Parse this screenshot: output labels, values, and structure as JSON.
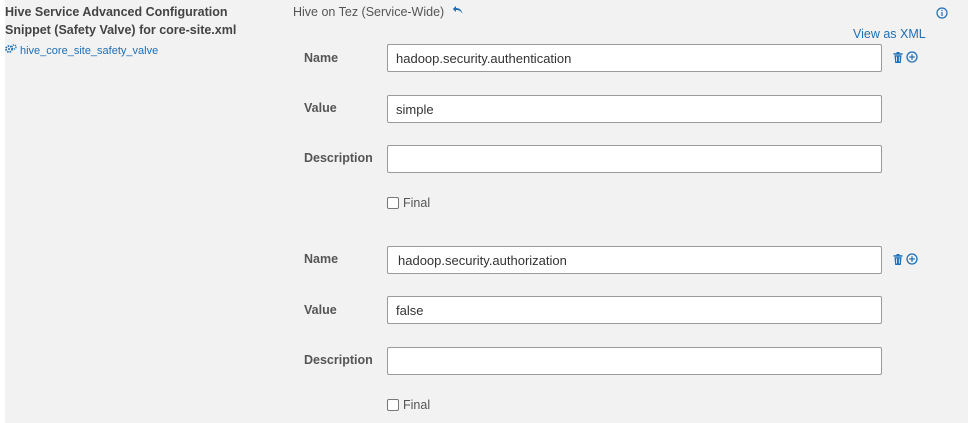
{
  "property": {
    "title": "Hive Service Advanced Configuration Snippet (Safety Valve) for core-site.xml",
    "key": "hive_core_site_safety_valve"
  },
  "scope": {
    "label": "Hive on Tez (Service-Wide)"
  },
  "view_as_xml_label": "View as XML",
  "labels": {
    "name": "Name",
    "value": "Value",
    "description": "Description",
    "final": "Final"
  },
  "entries": [
    {
      "name": "hadoop.security.authentication",
      "value": "simple",
      "description": "",
      "final": false
    },
    {
      "name": "hadoop.security.authorization",
      "value": "false",
      "description": "",
      "final": false
    }
  ],
  "colors": {
    "link": "#1f6fb5",
    "panel_bg": "#f2f2f2"
  },
  "icons": [
    "gears-icon",
    "undo-arrow-icon",
    "info-icon",
    "trash-icon",
    "add-circle-icon"
  ]
}
